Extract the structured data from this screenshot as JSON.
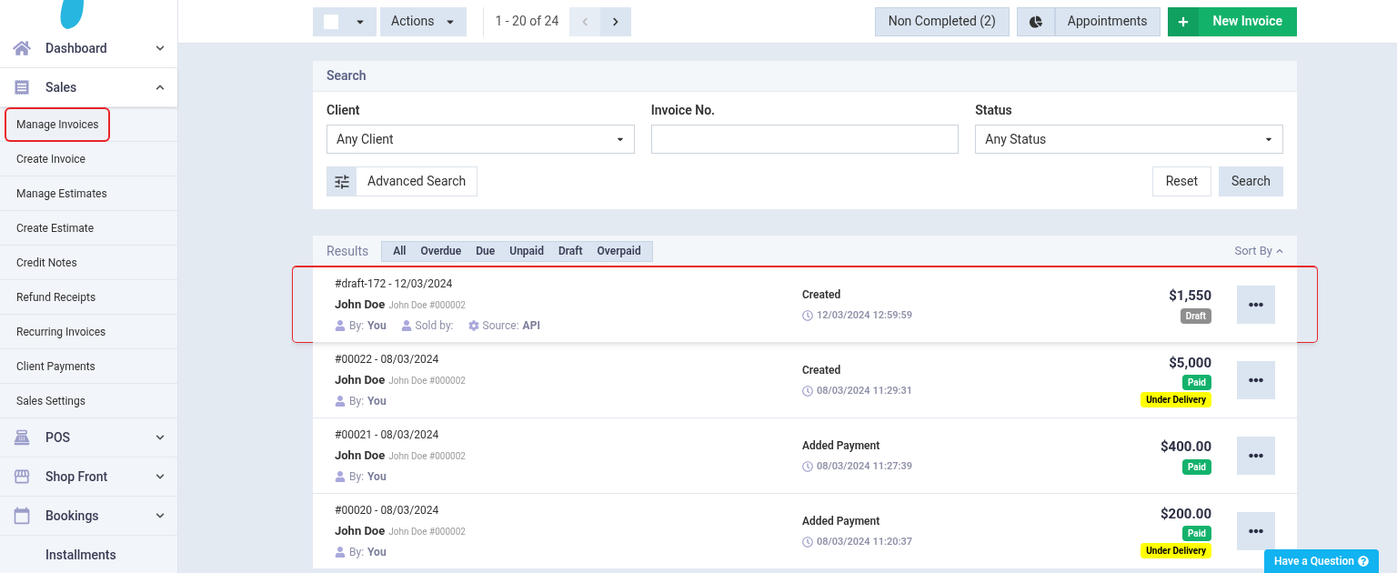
{
  "sidebar": {
    "items": [
      {
        "label": "Dashboard",
        "expanded": false
      },
      {
        "label": "Sales",
        "expanded": true,
        "children": [
          {
            "label": "Manage Invoices",
            "selected": true
          },
          {
            "label": "Create Invoice",
            "selected": false
          },
          {
            "label": "Manage Estimates",
            "selected": false
          },
          {
            "label": "Create Estimate",
            "selected": false
          },
          {
            "label": "Credit Notes",
            "selected": false
          },
          {
            "label": "Refund Receipts",
            "selected": false
          },
          {
            "label": "Recurring Invoices",
            "selected": false
          },
          {
            "label": "Client Payments",
            "selected": false
          },
          {
            "label": "Sales Settings",
            "selected": false
          }
        ]
      },
      {
        "label": "POS",
        "expanded": false
      },
      {
        "label": "Shop Front",
        "expanded": false
      },
      {
        "label": "Bookings",
        "expanded": false
      },
      {
        "label": "Installments"
      }
    ]
  },
  "toolbar": {
    "select_all_checked": false,
    "actions": "Actions",
    "pagination": "1 - 20 of 24",
    "non_completed": "Non Completed (2)",
    "appointments": "Appointments",
    "new_invoice": "New Invoice"
  },
  "search": {
    "title": "Search",
    "fields": [
      {
        "label": "Client",
        "kind": "select",
        "value": "Any Client"
      },
      {
        "label": "Invoice No.",
        "kind": "input"
      },
      {
        "label": "Status",
        "kind": "select",
        "value": "Any Status"
      }
    ],
    "advanced": "Advanced Search",
    "reset": "Reset",
    "search": "Search"
  },
  "results": {
    "title": "Results",
    "filters": [
      "All",
      "Overdue",
      "Due",
      "Unpaid",
      "Draft",
      "Overpaid"
    ],
    "sort": "Sort By",
    "rows": [
      {
        "number": "#draft-172 - 12/03/2024",
        "client": "John Doe",
        "client_ref": "John Doe #000002",
        "by_label": "By:",
        "by": "You",
        "sold_by": "Sold by:",
        "source_label": "Source:",
        "source": "API",
        "action": "Created",
        "time": "12/03/2024 12:59:59",
        "amount": "$1,550",
        "badges": [
          {
            "text": "Draft",
            "kind": "draft"
          }
        ],
        "highlighted": true
      },
      {
        "number": "#00022 - 08/03/2024",
        "client": "John Doe",
        "client_ref": "John Doe #000002",
        "by_label": "By:",
        "by": "You",
        "action": "Created",
        "time": "08/03/2024 11:29:31",
        "amount": "$5,000",
        "badges": [
          {
            "text": "Paid",
            "kind": "paid"
          },
          {
            "text": "Under Delivery",
            "kind": "delivery"
          }
        ],
        "highlighted": false
      },
      {
        "number": "#00021 - 08/03/2024",
        "client": "John Doe",
        "client_ref": "John Doe #000002",
        "by_label": "By:",
        "by": "You",
        "action": "Added Payment",
        "time": "08/03/2024 11:27:39",
        "amount": "$400.00",
        "badges": [
          {
            "text": "Paid",
            "kind": "paid"
          }
        ],
        "highlighted": false
      },
      {
        "number": "#00020 - 08/03/2024",
        "client": "John Doe",
        "client_ref": "John Doe #000002",
        "by_label": "By:",
        "by": "You",
        "action": "Added Payment",
        "time": "08/03/2024 11:20:37",
        "amount": "$200.00",
        "badges": [
          {
            "text": "Paid",
            "kind": "paid"
          },
          {
            "text": "Under Delivery",
            "kind": "delivery"
          }
        ],
        "highlighted": false
      }
    ]
  },
  "help": "Have a Question"
}
